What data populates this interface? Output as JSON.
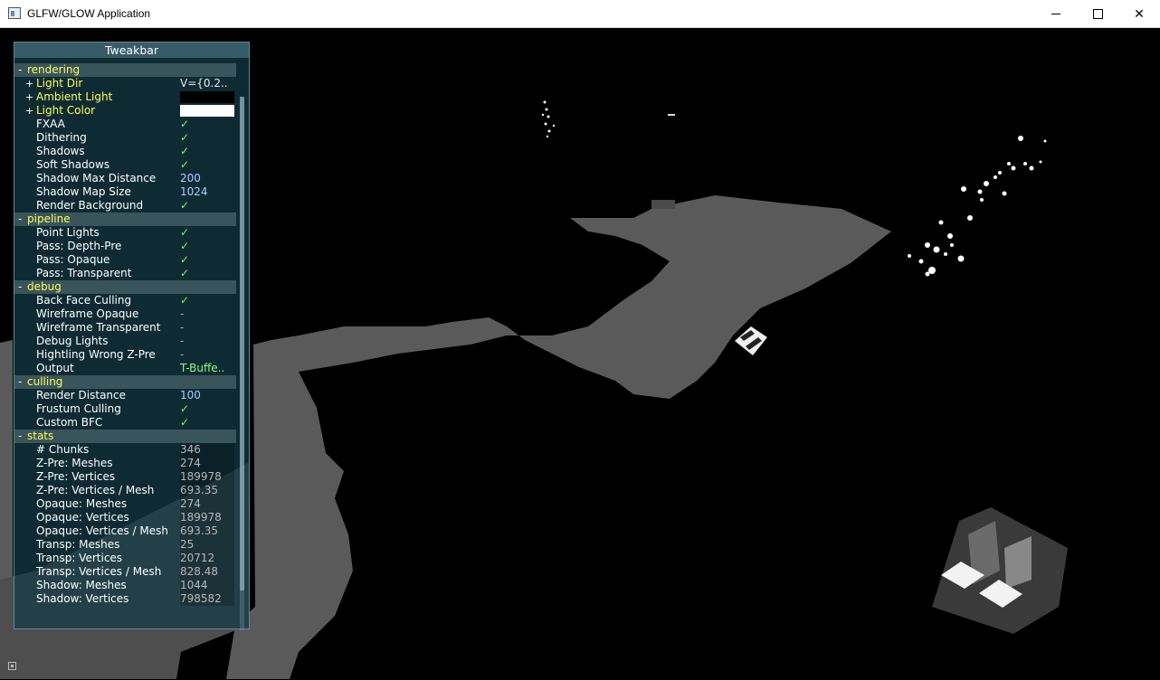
{
  "window": {
    "title": "GLFW/GLOW Application",
    "min_icon": "minimize-icon",
    "max_icon": "maximize-icon",
    "close_label": "✕"
  },
  "tweakbar": {
    "title": "Tweakbar",
    "groups": [
      {
        "name": "rendering",
        "toggle": "-",
        "rows": [
          {
            "label": "Light Dir",
            "expand": "+",
            "value": "V={0.2..",
            "kind": "vec",
            "highlight": true
          },
          {
            "label": "Ambient Light",
            "expand": "+",
            "value": "",
            "kind": "color",
            "color": "#000000",
            "highlight": true
          },
          {
            "label": "Light Color",
            "expand": "+",
            "value": "",
            "kind": "color",
            "color": "#ffffff",
            "highlight": true
          },
          {
            "label": "FXAA",
            "value": "✓",
            "kind": "check"
          },
          {
            "label": "Dithering",
            "value": "✓",
            "kind": "check"
          },
          {
            "label": "Shadows",
            "value": "✓",
            "kind": "check"
          },
          {
            "label": "Soft Shadows",
            "value": "✓",
            "kind": "check"
          },
          {
            "label": "Shadow Max Distance",
            "value": "200",
            "kind": "num"
          },
          {
            "label": "Shadow Map Size",
            "value": "1024",
            "kind": "num"
          },
          {
            "label": "Render Background",
            "value": "✓",
            "kind": "check"
          }
        ]
      },
      {
        "name": "pipeline",
        "toggle": "-",
        "rows": [
          {
            "label": "Point Lights",
            "value": "✓",
            "kind": "check"
          },
          {
            "label": "Pass: Depth-Pre",
            "value": "✓",
            "kind": "check"
          },
          {
            "label": "Pass: Opaque",
            "value": "✓",
            "kind": "check"
          },
          {
            "label": "Pass: Transparent",
            "value": "✓",
            "kind": "check"
          }
        ]
      },
      {
        "name": "debug",
        "toggle": "-",
        "rows": [
          {
            "label": "Back Face Culling",
            "value": "✓",
            "kind": "check"
          },
          {
            "label": "Wireframe Opaque",
            "value": "-",
            "kind": "dash"
          },
          {
            "label": "Wireframe Transparent",
            "value": "-",
            "kind": "dash"
          },
          {
            "label": "Debug Lights",
            "value": "-",
            "kind": "dash"
          },
          {
            "label": "Hightling Wrong Z-Pre",
            "value": "-",
            "kind": "dash"
          },
          {
            "label": "Output",
            "value": "T-Buffe..",
            "kind": "enum"
          }
        ]
      },
      {
        "name": "culling",
        "toggle": "-",
        "rows": [
          {
            "label": "Render Distance",
            "value": "100",
            "kind": "num"
          },
          {
            "label": "Frustum Culling",
            "value": "✓",
            "kind": "check"
          },
          {
            "label": "Custom BFC",
            "value": "✓",
            "kind": "check"
          }
        ]
      },
      {
        "name": "stats",
        "toggle": "-",
        "rows": [
          {
            "label": "# Chunks",
            "value": "346",
            "kind": "stat"
          },
          {
            "label": "Z-Pre: Meshes",
            "value": "274",
            "kind": "stat"
          },
          {
            "label": "Z-Pre: Vertices",
            "value": "189978",
            "kind": "stat"
          },
          {
            "label": "Z-Pre: Vertices / Mesh",
            "value": "693.35",
            "kind": "stat"
          },
          {
            "label": "Opaque: Meshes",
            "value": "274",
            "kind": "stat"
          },
          {
            "label": "Opaque: Vertices",
            "value": "189978",
            "kind": "stat"
          },
          {
            "label": "Opaque: Vertices / Mesh",
            "value": "693.35",
            "kind": "stat"
          },
          {
            "label": "Transp: Meshes",
            "value": "25",
            "kind": "stat"
          },
          {
            "label": "Transp: Vertices",
            "value": "20712",
            "kind": "stat"
          },
          {
            "label": "Transp: Vertices / Mesh",
            "value": "828.48",
            "kind": "stat"
          },
          {
            "label": "Shadow: Meshes",
            "value": "1044",
            "kind": "stat"
          },
          {
            "label": "Shadow: Vertices",
            "value": "798582",
            "kind": "stat"
          }
        ]
      }
    ]
  },
  "colors": {
    "group_name": "#ffff55",
    "check": "#66ff66",
    "number": "#aaccff",
    "scene_surface": "#5a5a5a"
  }
}
